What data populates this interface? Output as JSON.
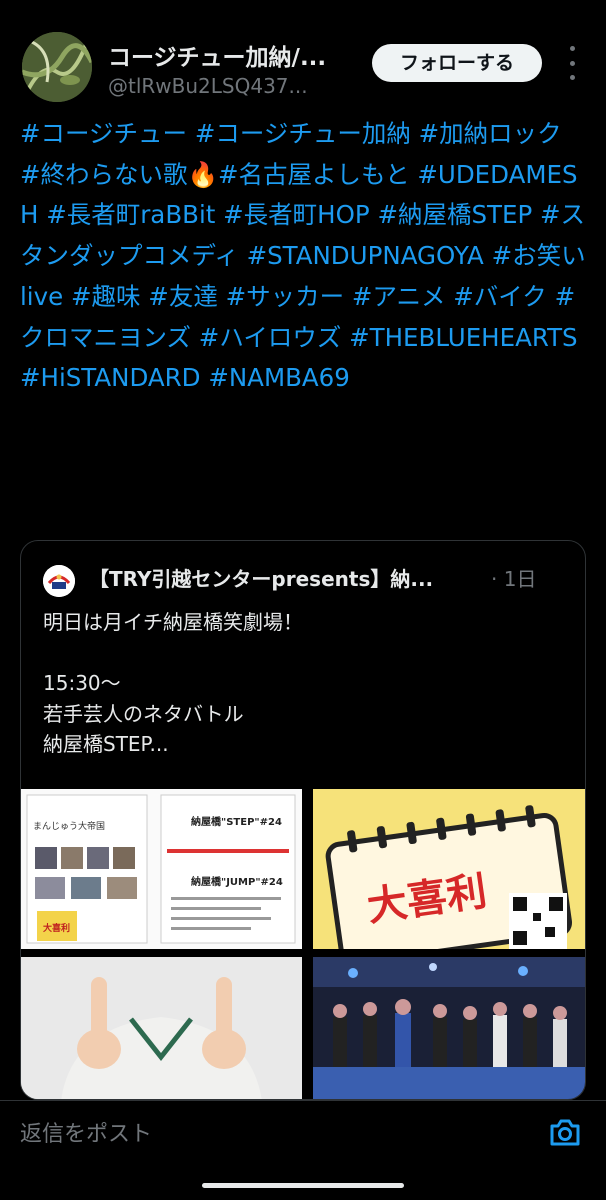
{
  "author": {
    "display_name": "コージチュー加納/...",
    "handle": "@tlRwBu2LSQ437..."
  },
  "follow_button": {
    "label": "フォローする"
  },
  "tweet_text": "#コージチュー #コージチュー加納 #加納ロック #終わらない歌🔥#名古屋よしもと #UDEDAMESH #長者町raBBit #長者町HOP #納屋橋STEP #スタンダップコメディ #STANDUPNAGOYA #お笑いlive #趣味 #友達 #サッカー #アニメ #バイク #クロマニヨンズ #ハイロウズ #THEBLUEHEARTS #HiSTANDARD #NAMBA69",
  "quote": {
    "author_name": "【TRY引越センターpresents】納...",
    "time": "· 1日",
    "text": "明日は月イチ納屋橋笑劇場！\n\n15:30〜\n若手芸人のネタバトル\n納屋橋STEP..."
  },
  "images": {
    "img1_label": "まんじゅう大帝国",
    "img1_step": "納屋橋\"STEP\"#24",
    "img1_jump": "納屋橋\"JUMP\"#24",
    "img1_badge": "大喜利",
    "img2_title": "大喜利"
  },
  "reply": {
    "placeholder": "返信をポスト"
  },
  "colors": {
    "link": "#1d9bf0",
    "secondary_text": "#71767b",
    "border": "#2f3336"
  },
  "icons": {
    "more": "vertical-ellipsis-icon",
    "camera": "camera-icon"
  }
}
